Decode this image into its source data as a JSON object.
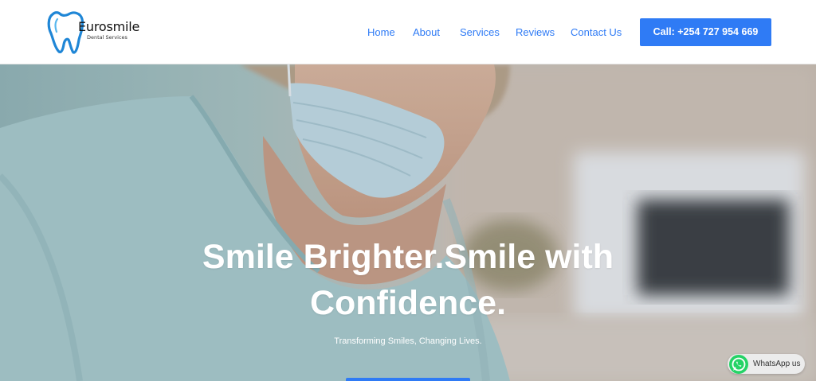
{
  "brand": {
    "name": "Eurosmile",
    "tagline": "Dental Services",
    "accent_color": "#2f7bf5"
  },
  "nav": {
    "items": [
      {
        "label": "Home"
      },
      {
        "label": "About"
      },
      {
        "label": "Services"
      },
      {
        "label": "Reviews"
      },
      {
        "label": "Contact Us"
      }
    ],
    "cta_label": "Call: +254 727 954 669"
  },
  "hero": {
    "title": "Smile Brighter.Smile with Confidence.",
    "subtitle": "Transforming Smiles, Changing Lives."
  },
  "whatsapp": {
    "label": "WhatsApp us",
    "icon": "whatsapp-icon",
    "color": "#25d366"
  }
}
